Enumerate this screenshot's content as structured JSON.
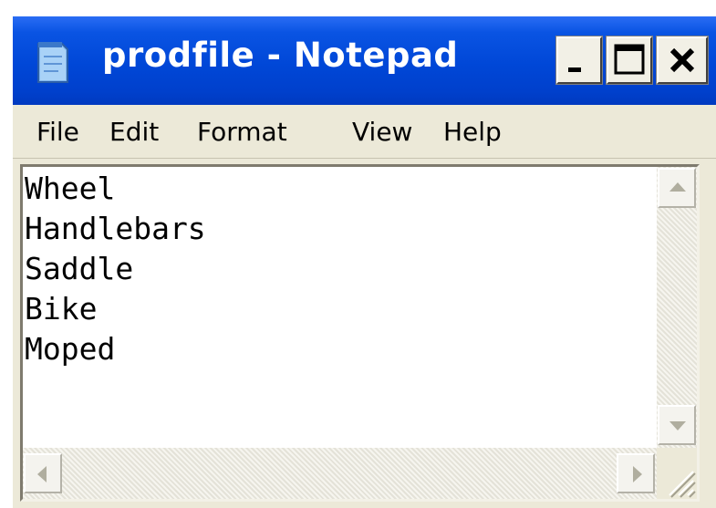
{
  "window": {
    "title": "prodfile - Notepad",
    "icon": "notepad-icon",
    "controls": [
      "minimize-icon",
      "maximize-icon",
      "close-icon"
    ]
  },
  "menu": {
    "items": [
      {
        "label": "File"
      },
      {
        "label": "Edit"
      },
      {
        "label": "Format"
      },
      {
        "label": "View"
      },
      {
        "label": "Help"
      }
    ]
  },
  "document": {
    "lines": [
      "Wheel",
      "Handlebars",
      "Saddle",
      "Bike",
      "Moped"
    ]
  },
  "colors": {
    "titlebar": "#0a54e3",
    "chrome": "#ece9d8",
    "editor_background": "#ffffff"
  }
}
